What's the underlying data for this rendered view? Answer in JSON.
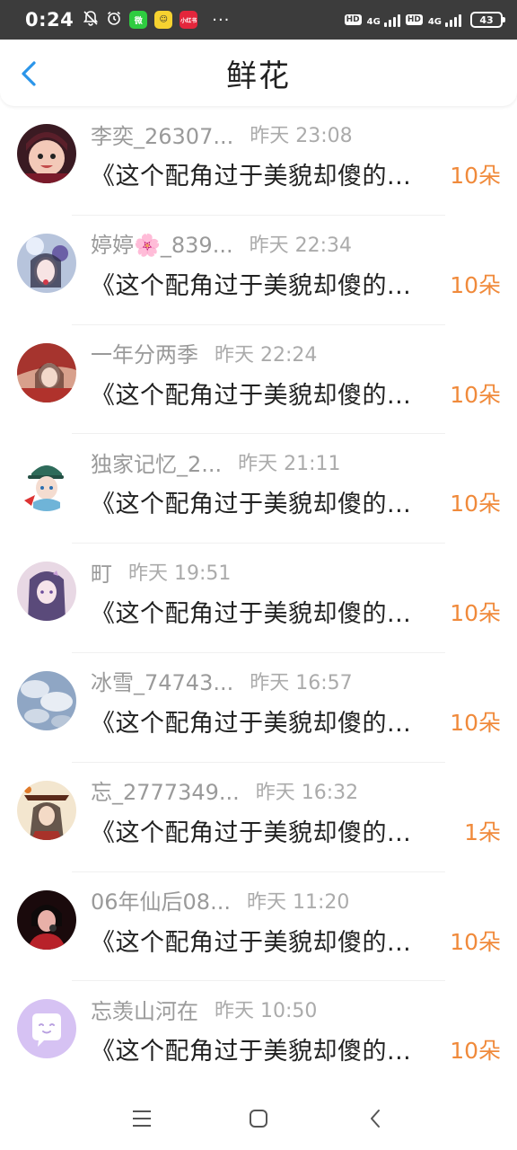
{
  "status_bar": {
    "time": "0:24",
    "app_chip_1": "微",
    "app_chip_2": "☺",
    "app_chip_3": "小红书",
    "dots": "···",
    "hd_1": "HD",
    "net_1": "4G",
    "hd_2": "HD",
    "net_2": "4G",
    "battery": "43"
  },
  "header": {
    "title": "鲜花"
  },
  "rows": [
    {
      "name": "李奕_26307...",
      "time": "昨天 23:08",
      "title": "《这个配角过于美貌却傻的...",
      "count": "10朵"
    },
    {
      "name": "婷婷🌸_839...",
      "time": "昨天 22:34",
      "title": "《这个配角过于美貌却傻的...",
      "count": "10朵"
    },
    {
      "name": "一年分两季",
      "time": "昨天 22:24",
      "title": "《这个配角过于美貌却傻的...",
      "count": "10朵"
    },
    {
      "name": "独家记忆_2...",
      "time": "昨天 21:11",
      "title": "《这个配角过于美貌却傻的...",
      "count": "10朵"
    },
    {
      "name": "町",
      "time": "昨天 19:51",
      "title": "《这个配角过于美貌却傻的...",
      "count": "10朵"
    },
    {
      "name": "冰雪_74743...",
      "time": "昨天 16:57",
      "title": "《这个配角过于美貌却傻的...",
      "count": "10朵"
    },
    {
      "name": "忘_2777349...",
      "time": "昨天 16:32",
      "title": "《这个配角过于美貌却傻的...",
      "count": "1朵"
    },
    {
      "name": "06年仙后08...",
      "time": "昨天 11:20",
      "title": "《这个配角过于美貌却傻的...",
      "count": "10朵"
    },
    {
      "name": "忘羡山河在",
      "time": "昨天 10:50",
      "title": "《这个配角过于美貌却傻的...",
      "count": "10朵"
    }
  ],
  "colors": {
    "accent_blue": "#2b95e9",
    "count_orange": "#f08a3b"
  }
}
